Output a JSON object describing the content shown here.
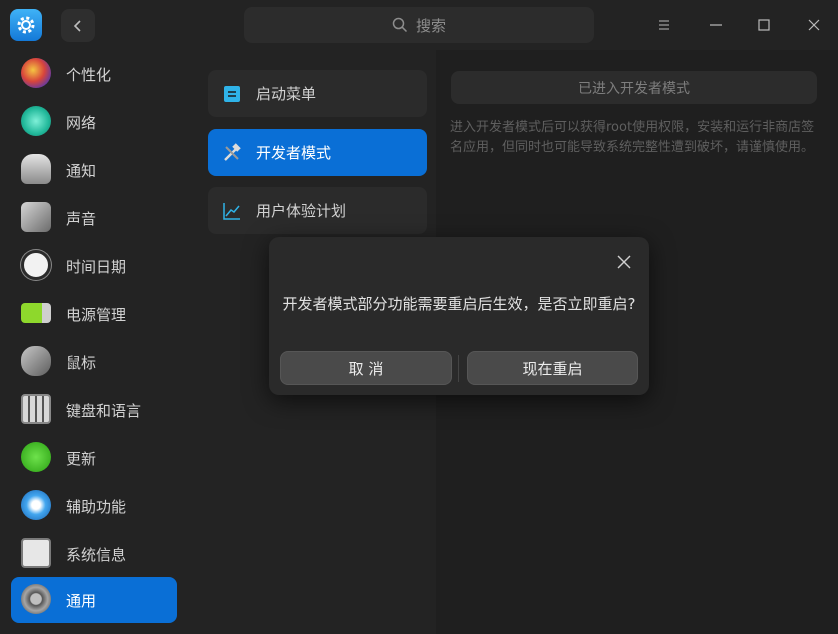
{
  "titlebar": {
    "search_placeholder": "搜索",
    "icons": [
      "settings-app-icon",
      "back-icon",
      "search-icon",
      "menu-icon",
      "minimize-icon",
      "maximize-icon",
      "close-icon"
    ]
  },
  "sidebar": {
    "items": [
      {
        "label": "个性化",
        "icon": "personalization-icon",
        "active": false
      },
      {
        "label": "网络",
        "icon": "network-icon",
        "active": false
      },
      {
        "label": "通知",
        "icon": "notification-icon",
        "active": false
      },
      {
        "label": "声音",
        "icon": "sound-icon",
        "active": false
      },
      {
        "label": "时间日期",
        "icon": "clock-icon",
        "active": false
      },
      {
        "label": "电源管理",
        "icon": "battery-icon",
        "active": false
      },
      {
        "label": "鼠标",
        "icon": "mouse-icon",
        "active": false
      },
      {
        "label": "键盘和语言",
        "icon": "keyboard-icon",
        "active": false
      },
      {
        "label": "更新",
        "icon": "update-icon",
        "active": false
      },
      {
        "label": "辅助功能",
        "icon": "accessibility-icon",
        "active": false
      },
      {
        "label": "系统信息",
        "icon": "system-info-icon",
        "active": false
      },
      {
        "label": "通用",
        "icon": "general-icon",
        "active": true
      }
    ]
  },
  "submenu": {
    "items": [
      {
        "label": "启动菜单",
        "icon": "boot-menu-icon",
        "active": false
      },
      {
        "label": "开发者模式",
        "icon": "developer-tools-icon",
        "active": true
      },
      {
        "label": "用户体验计划",
        "icon": "chart-trend-icon",
        "active": false
      }
    ]
  },
  "content": {
    "dev_mode_button": "已进入开发者模式",
    "description": "进入开发者模式后可以获得root使用权限，安装和运行非商店签名应用，但同时也可能导致系统完整性遭到破坏，请谨慎使用。"
  },
  "dialog": {
    "message": "开发者模式部分功能需要重启后生效，是否立即重启?",
    "cancel_label": "取 消",
    "restart_label": "现在重启"
  },
  "colors": {
    "accent": "#0a6fd6",
    "background": "#1f1f1f",
    "panel": "#232323"
  }
}
